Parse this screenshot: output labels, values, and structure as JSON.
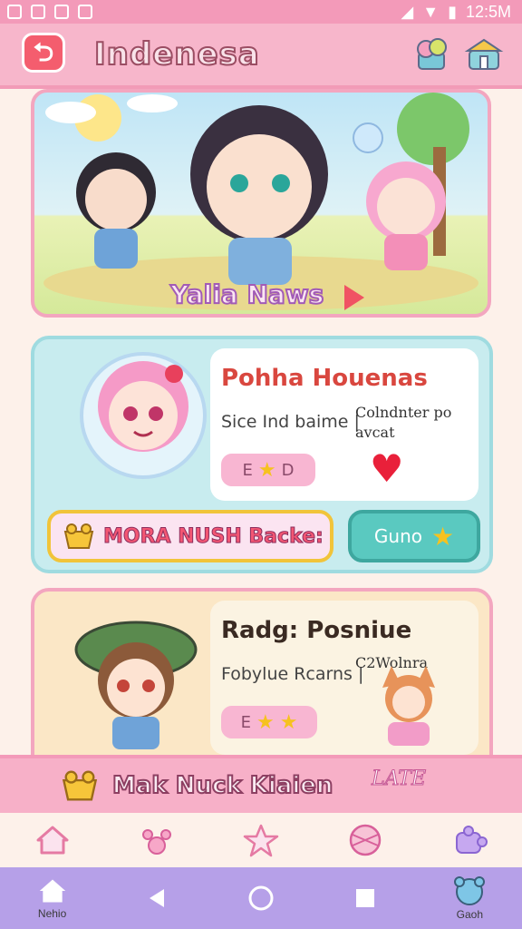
{
  "status_bar": {
    "time": "12:5M"
  },
  "header": {
    "title": "Indenesa"
  },
  "banner": {
    "title": "Yalia Naws"
  },
  "cards": [
    {
      "name": "Pohha Houenas",
      "subtitle": "Sice Ind baime |",
      "tag": "Colndnter po avcat",
      "pill_text": "E",
      "pill_text2": "D",
      "wide_button": "MORA NUSH Backe:",
      "action_button": "Guno",
      "name_color": "#d9473f"
    },
    {
      "name": "Radg: Posniue",
      "subtitle": "Fobylue Rcarns |",
      "tag": "C2Wolnra",
      "pill_text": "E",
      "badge": "LATE"
    }
  ],
  "bottom_strip": {
    "label": "Mak Nuck Kiaien"
  },
  "tabbar": {
    "items": [
      {
        "icon": "home-icon"
      },
      {
        "icon": "paw-icon"
      },
      {
        "icon": "star-icon"
      },
      {
        "icon": "ball-icon"
      },
      {
        "icon": "puzzle-icon"
      }
    ]
  },
  "navbar": {
    "home_label": "Nehio",
    "profile_label": "Gaoh"
  }
}
